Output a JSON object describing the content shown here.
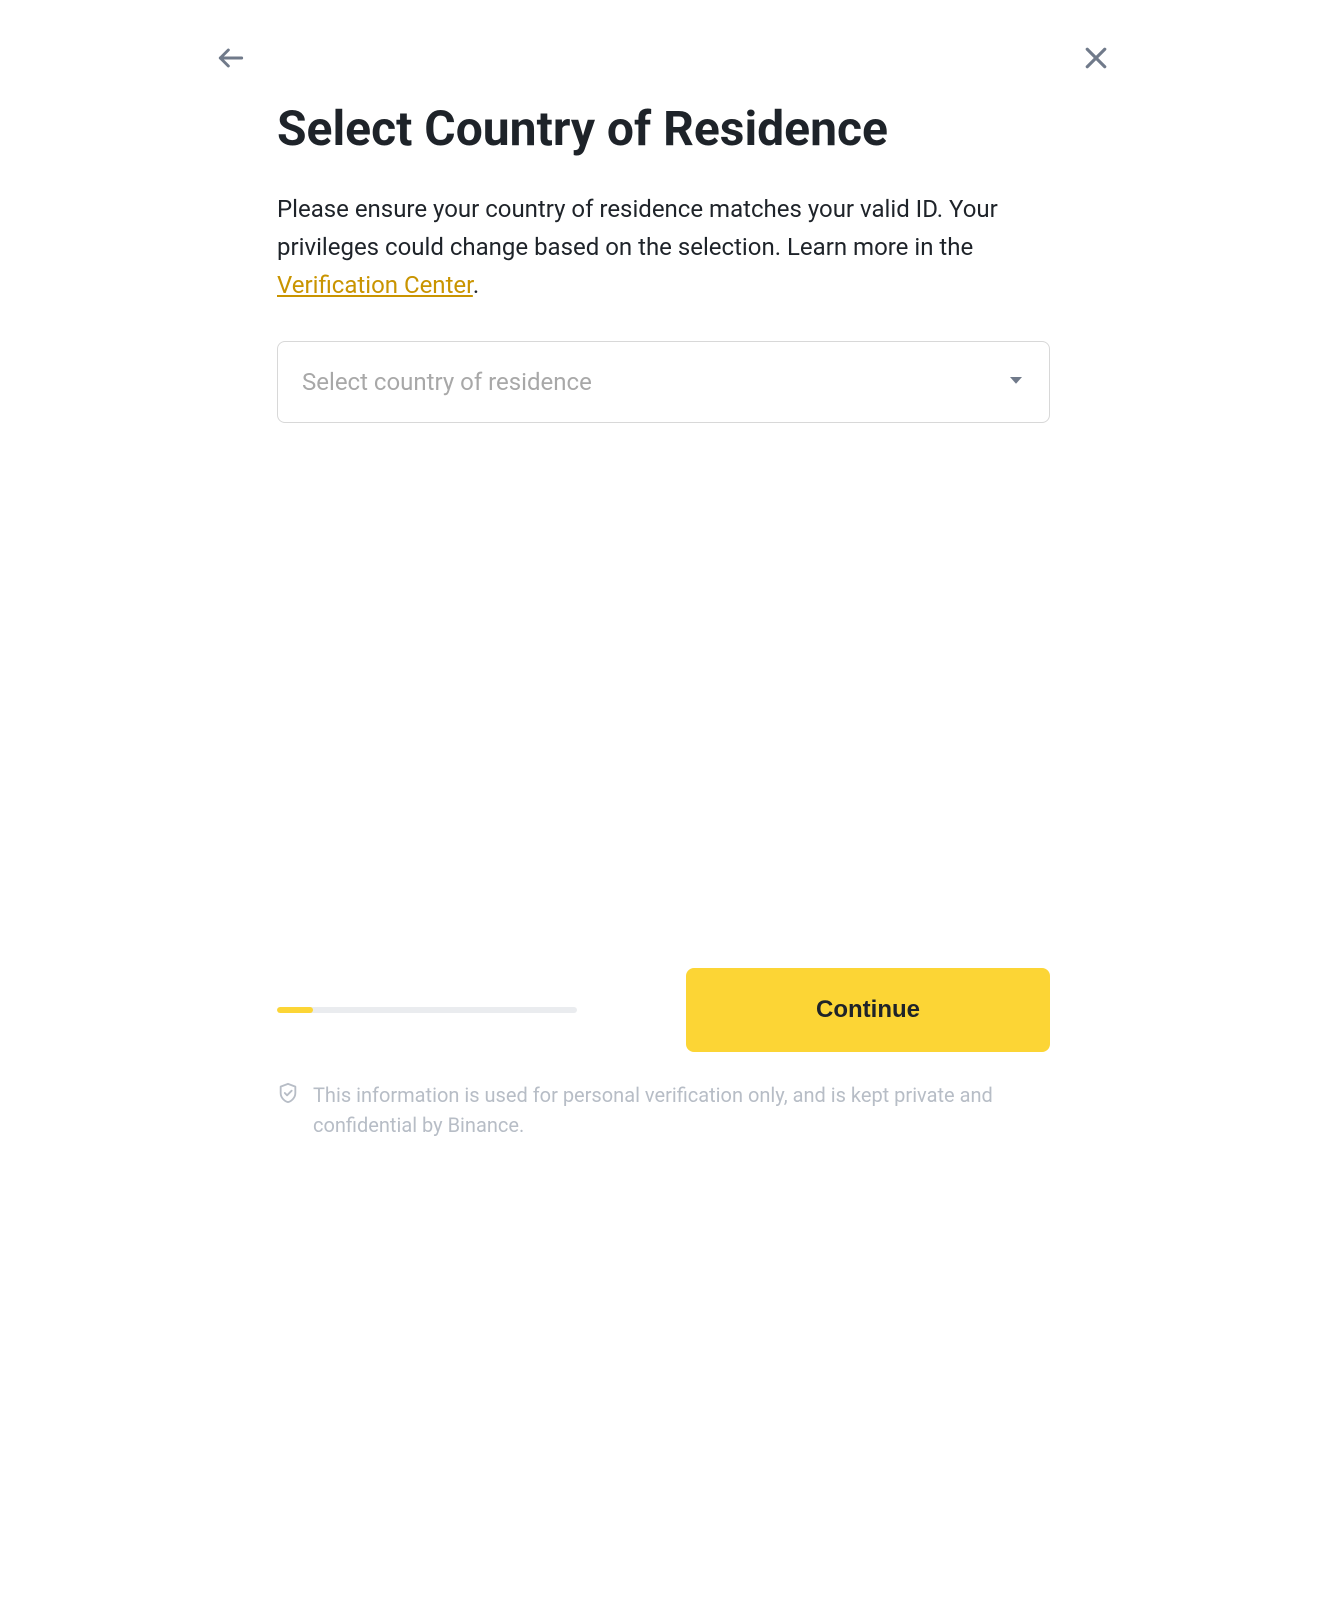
{
  "header": {
    "title": "Select Country of Residence"
  },
  "body": {
    "description_prefix": "Please ensure your country of residence matches your valid ID. Your privileges could change based on the selection. Learn more in the ",
    "link_text": "Verification Center",
    "description_suffix": "."
  },
  "select": {
    "placeholder": "Select country of residence",
    "value": ""
  },
  "footer": {
    "progress_percent": 12,
    "continue_label": "Continue",
    "privacy_text": "This information is used for personal verification only, and is kept private and confidential by Binance."
  },
  "colors": {
    "accent": "#fcd535",
    "link": "#c99400"
  }
}
